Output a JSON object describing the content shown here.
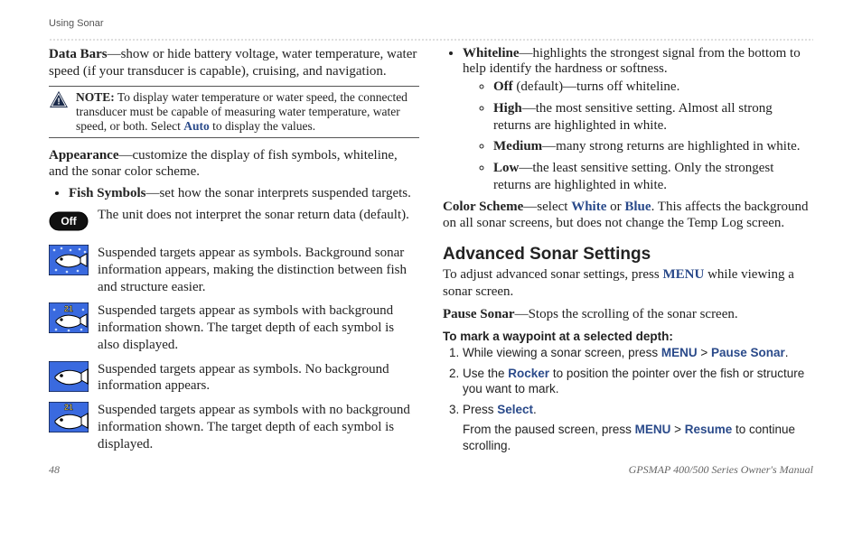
{
  "header": {
    "section": "Using Sonar"
  },
  "left": {
    "data_bars_label": "Data Bars",
    "data_bars_text": "—show or hide battery voltage, water temperature, water speed (if your transducer is capable), cruising, and navigation.",
    "note_label": "NOTE:",
    "note_text": " To display water temperature or water speed, the connected transducer must be capable of measuring water temperature, water speed, or both. Select ",
    "note_auto": "Auto",
    "note_text2": " to display the values.",
    "appearance_label": "Appearance",
    "appearance_text": "—customize the display of fish symbols, whiteline, and the sonar color scheme.",
    "fish_symbols_label": "Fish Symbols",
    "fish_symbols_text": "—set how the sonar interprets suspended targets.",
    "rows": [
      "The unit does not interpret the sonar return data (default).",
      "Suspended targets appear as symbols. Background sonar information appears, making the distinction between fish and structure easier.",
      "Suspended targets appear as symbols with background information shown. The target depth of each symbol is also displayed.",
      "Suspended targets appear as symbols. No background information appears.",
      "Suspended targets appear as symbols with no background information shown. The target depth of each symbol is displayed."
    ],
    "depth_label": "21",
    "off_label": "Off"
  },
  "right": {
    "whiteline_label": "Whiteline",
    "whiteline_text": "—highlights the strongest signal from the bottom to help identify the hardness or softness.",
    "wl": [
      {
        "k": "Off",
        "v": " (default)—turns off whiteline."
      },
      {
        "k": "High",
        "v": "—the most sensitive setting. Almost all strong returns are highlighted in white."
      },
      {
        "k": "Medium",
        "v": "—many strong returns are highlighted in white."
      },
      {
        "k": "Low",
        "v": "—the least sensitive setting. Only the strongest returns are highlighted in white."
      }
    ],
    "color_label": "Color Scheme",
    "color_pre": "—select ",
    "color_white": "White",
    "color_or": " or ",
    "color_blue": "Blue",
    "color_post": ". This affects the background on all sonar screens, but does not change the Temp Log screen.",
    "adv_heading": "Advanced Sonar Settings",
    "adv_text_pre": "To adjust advanced sonar settings, press ",
    "adv_menu": "MENU",
    "adv_text_post": " while viewing a sonar screen.",
    "pause_label": "Pause Sonar",
    "pause_text": "—Stops the scrolling of the sonar screen.",
    "steps_head": "To mark a waypoint at a selected depth:",
    "s1_a": "While viewing a sonar screen, press ",
    "s1_m": "MENU",
    "s1_gt": " > ",
    "s1_p": "Pause Sonar",
    "s1_end": ".",
    "s2_a": "Use the ",
    "s2_r": "Rocker",
    "s2_b": " to position the pointer over the fish or structure you want to mark.",
    "s3_a": "Press ",
    "s3_s": "Select",
    "s3_end": ".",
    "s4_a": "From the paused screen, press ",
    "s4_m": "MENU",
    "s4_gt": " > ",
    "s4_r": "Resume",
    "s4_b": " to continue scrolling."
  },
  "footer": {
    "page": "48",
    "title": "GPSMAP 400/500 Series Owner's Manual"
  }
}
